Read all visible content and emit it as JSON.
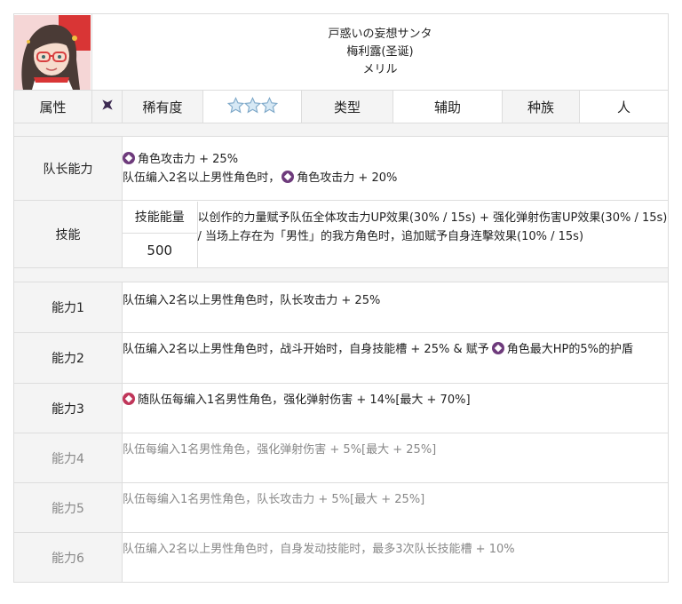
{
  "header": {
    "name_jp": "戸惑いの妄想サンタ",
    "name_cn": "梅利露(圣诞)",
    "name_kana": "メリル"
  },
  "info": {
    "attribute_label": "属性",
    "attribute_icon": "void-attribute-icon",
    "rarity_label": "稀有度",
    "rarity_stars": 3,
    "type_label": "类型",
    "type_value": "辅助",
    "race_label": "种族",
    "race_value": "人"
  },
  "leader": {
    "label": "队长能力",
    "line1": "角色攻击力 + 25%",
    "line2_prefix": "队伍编入2名以上男性角色时，",
    "line2_suffix": "角色攻击力 + 20%"
  },
  "skill": {
    "label": "技能",
    "energy_label": "技能能量",
    "energy_value": "500",
    "description": "以创作的力量赋予队伍全体攻击力UP效果(30% / 15s) + 强化弹射伤害UP效果(30% / 15s) / 当场上存在为「男性」的我方角色时，追加赋予自身连擊效果(10% / 15s)"
  },
  "abilities": [
    {
      "label": "能力1",
      "prefix": "",
      "text": "队伍编入2名以上男性角色时，队长攻击力 + 25%"
    },
    {
      "label": "能力2",
      "prefix": "队伍编入2名以上男性角色时，战斗开始时，自身技能槽 + 25% & 赋予",
      "text": "角色最大HP的5%的护盾"
    },
    {
      "label": "能力3",
      "prefix": "",
      "text": "随队伍每编入1名男性角色，强化弹射伤害 + 14%[最大 + 70%]"
    },
    {
      "label": "能力4",
      "prefix": "",
      "text": "队伍每编入1名男性角色，强化弹射伤害 + 5%[最大 + 25%]"
    },
    {
      "label": "能力5",
      "prefix": "",
      "text": "队伍每编入1名男性角色，队长攻击力 + 5%[最大 + 25%]"
    },
    {
      "label": "能力6",
      "prefix": "",
      "text": "队伍编入2名以上男性角色时，自身发动技能时，最多3次队长技能槽 + 10%"
    }
  ],
  "colors": {
    "label_bg": "#f4f4f4",
    "border": "#dddddd",
    "buff_icon": "#6e3b7c",
    "buff_icon_red": "#c0365a",
    "dim_text": "#888888"
  }
}
